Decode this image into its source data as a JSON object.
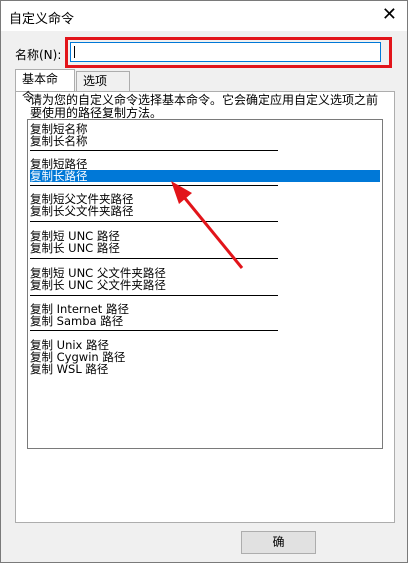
{
  "window": {
    "title": "自定义命令",
    "close_glyph": "✕"
  },
  "name_field": {
    "label": "名称(N):",
    "value": ""
  },
  "tabs": [
    {
      "label": "基本命令"
    },
    {
      "label": "选项"
    }
  ],
  "description": "请为您的自定义命令选择基本命令。它会确定应用自定义选项之前要使用的路径复制方法。",
  "list": {
    "groups": [
      [
        "复制短名称",
        "复制长名称"
      ],
      [
        "复制短路径",
        "复制长路径"
      ],
      [
        "复制短父文件夹路径",
        "复制长父文件夹路径"
      ],
      [
        "复制短 UNC 路径",
        "复制长 UNC 路径"
      ],
      [
        "复制短 UNC 父文件夹路径",
        "复制长 UNC 父文件夹路径"
      ],
      [
        "复制 Internet 路径",
        "复制 Samba 路径"
      ],
      [
        "复制 Unix 路径",
        "复制 Cygwin 路径",
        "复制 WSL 路径"
      ]
    ],
    "selected": "复制长路径"
  },
  "buttons": {
    "ok_label": "确"
  },
  "colors": {
    "selection": "#0078d7",
    "highlight_box": "#e2141a",
    "arrow": "#e2141a"
  }
}
